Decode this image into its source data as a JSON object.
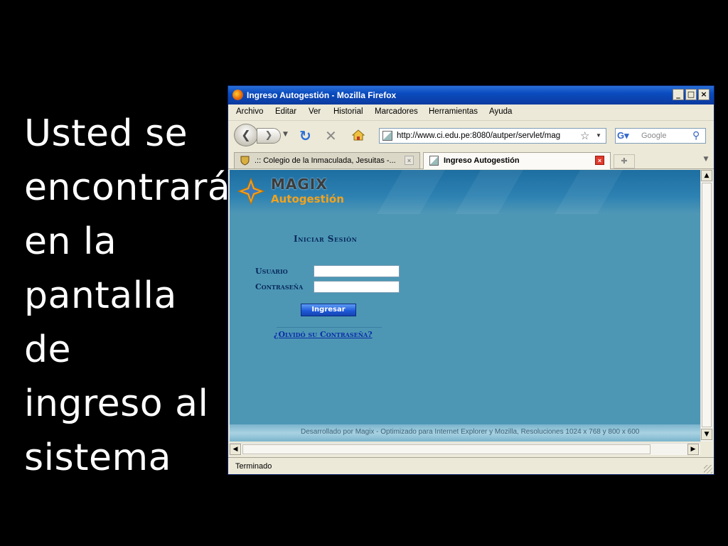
{
  "slide": {
    "text": "Usted se\nencontrará\nen la\npantalla de\ningreso al\nsistema"
  },
  "window": {
    "title": "Ingreso Autogestión - Mozilla Firefox",
    "buttons": [
      "_",
      "□",
      "×"
    ]
  },
  "menu": {
    "items": [
      "Archivo",
      "Editar",
      "Ver",
      "Historial",
      "Marcadores",
      "Herramientas",
      "Ayuda"
    ]
  },
  "navigation": {
    "url": "http://www.ci.edu.pe:8080/autper/servlet/mag",
    "search_placeholder": "Google",
    "search_engine_icon": "google-icon"
  },
  "tabs": [
    {
      "label": ".:: Colegio de la Inmaculada, Jesuitas -...",
      "active": false
    },
    {
      "label": "Ingreso Autogestión",
      "active": true
    }
  ],
  "page": {
    "logo_main": "MAGIX",
    "logo_sub": "Autogestión",
    "login_title": "Iniciar Sesión",
    "user_label": "Usuario",
    "password_label": "Contraseña",
    "submit_label": "Ingresar",
    "forgot_link": "¿Olvidó su Contraseña?",
    "footer": "Desarrollado por Magix - Optimizado para Internet Explorer y Mozilla, Resoluciones 1024 x 768 y 800 x 600",
    "colors": {
      "background": "#4d97b5",
      "label": "#08295a",
      "link": "#0b2ea8",
      "button": "#1d57d6",
      "logo_accent": "#f3a21c"
    }
  },
  "status": {
    "text": "Terminado"
  }
}
